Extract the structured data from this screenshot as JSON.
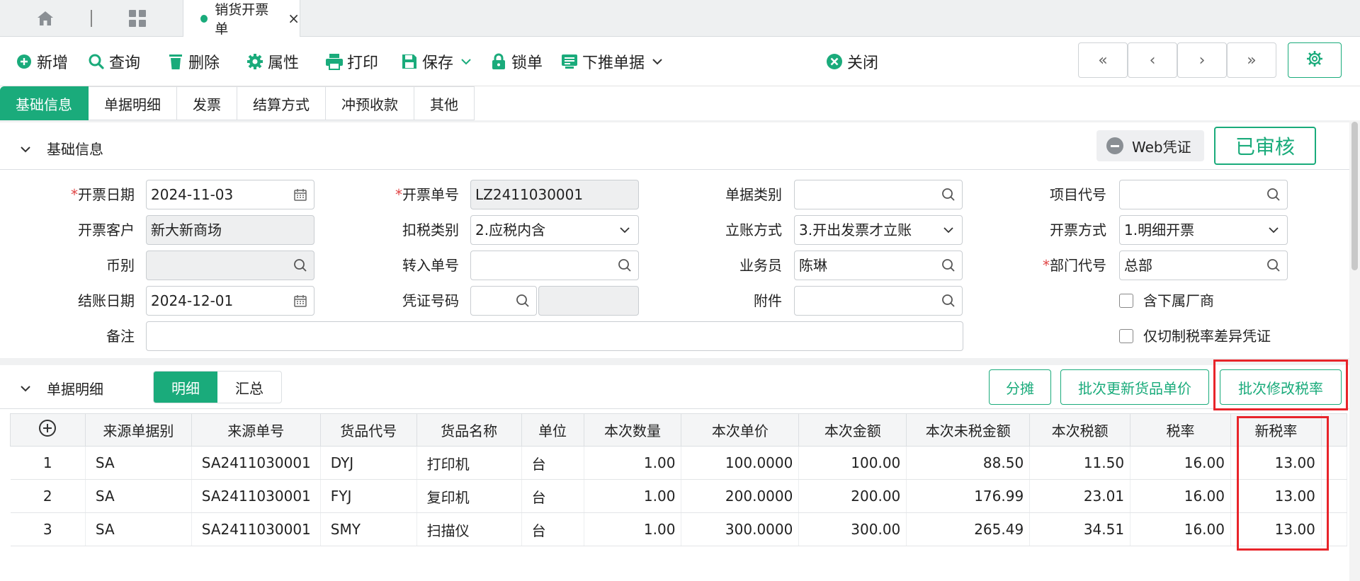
{
  "topbar": {
    "doc_tab_label": "销货开票单",
    "close_glyph": "×"
  },
  "toolbar": {
    "buttons": [
      "新增",
      "查询",
      "删除",
      "属性",
      "打印",
      "保存",
      "锁单",
      "下推单据",
      "关闭"
    ]
  },
  "nav": {
    "first": "«",
    "prev": "‹",
    "next": "›",
    "last": "»"
  },
  "section_tabs": [
    "基础信息",
    "单据明细",
    "发票",
    "结算方式",
    "冲预收款",
    "其他"
  ],
  "basic": {
    "title": "基础信息",
    "web_voucher": "Web凭证",
    "status": "已审核",
    "fields": {
      "invoice_date_label": "开票日期",
      "invoice_date": "2024-11-03",
      "invoice_no_label": "开票单号",
      "invoice_no": "LZ2411030001",
      "doc_type_label": "单据类别",
      "doc_type": "",
      "project_label": "项目代号",
      "project": "",
      "customer_label": "开票客户",
      "customer": "新大新商场",
      "tax_type_label": "扣税类别",
      "tax_type": "2.应税内含",
      "account_mode_label": "立账方式",
      "account_mode": "3.开出发票才立账",
      "invoice_mode_label": "开票方式",
      "invoice_mode": "1.明细开票",
      "currency_label": "币别",
      "currency": "",
      "transfer_no_label": "转入单号",
      "transfer_no": "",
      "salesman_label": "业务员",
      "salesman": "陈琳",
      "dept_label": "部门代号",
      "dept": "总部",
      "close_date_label": "结账日期",
      "close_date": "2024-12-01",
      "voucher_no_label": "凭证号码",
      "voucher_no": "",
      "attachment_label": "附件",
      "attachment": "",
      "include_sub_label": "含下属厂商",
      "only_diff_label": "仅切制税率差异凭证",
      "remark_label": "备注",
      "remark": ""
    }
  },
  "detail": {
    "title": "单据明细",
    "view_detail": "明细",
    "view_summary": "汇总",
    "btn_allocate": "分摊",
    "btn_update_price": "批次更新货品单价",
    "btn_change_rate": "批次修改税率",
    "columns": [
      "来源单据别",
      "来源单号",
      "货品代号",
      "货品名称",
      "单位",
      "本次数量",
      "本次单价",
      "本次金额",
      "本次未税金额",
      "本次税额",
      "税率",
      "新税率"
    ],
    "rows": [
      [
        "1",
        "SA",
        "SA2411030001",
        "DYJ",
        "打印机",
        "台",
        "1.00",
        "100.0000",
        "100.00",
        "88.50",
        "11.50",
        "16.00",
        "13.00"
      ],
      [
        "2",
        "SA",
        "SA2411030001",
        "FYJ",
        "复印机",
        "台",
        "1.00",
        "200.0000",
        "200.00",
        "176.99",
        "23.01",
        "16.00",
        "13.00"
      ],
      [
        "3",
        "SA",
        "SA2411030001",
        "SMY",
        "扫描仪",
        "台",
        "1.00",
        "300.0000",
        "300.00",
        "265.49",
        "34.51",
        "16.00",
        "13.00"
      ]
    ]
  },
  "colors": {
    "accent": "#1aab7b",
    "highlight": "#e8242a"
  }
}
